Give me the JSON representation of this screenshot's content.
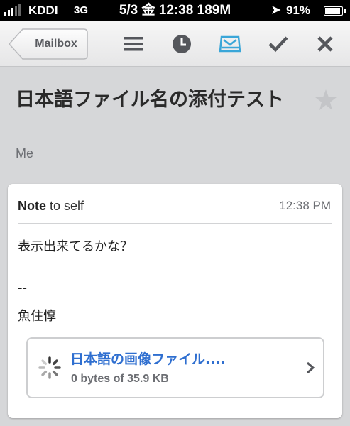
{
  "status_bar": {
    "carrier": "KDDI",
    "network": "3G",
    "datetime": "5/3 金 12:38 189M",
    "battery_percent": "91%",
    "battery_level": 0.91
  },
  "toolbar": {
    "back_label": "Mailbox",
    "icons": [
      "list-icon",
      "clock-icon",
      "inbox-tray-icon",
      "check-icon",
      "close-icon"
    ],
    "accent_color": "#3aa6d8"
  },
  "message": {
    "subject": "日本語ファイル名の添付テスト",
    "sender": "Me",
    "note_bold": "Note",
    "note_rest": " to self",
    "time": "12:38 PM",
    "body": [
      "表示出来てるかな？",
      "--",
      "魚住惇"
    ]
  },
  "attachment": {
    "name": "日本語の画像ファイル....",
    "progress": "0 bytes of 35.9 KB",
    "link_color": "#2f6fd0"
  }
}
